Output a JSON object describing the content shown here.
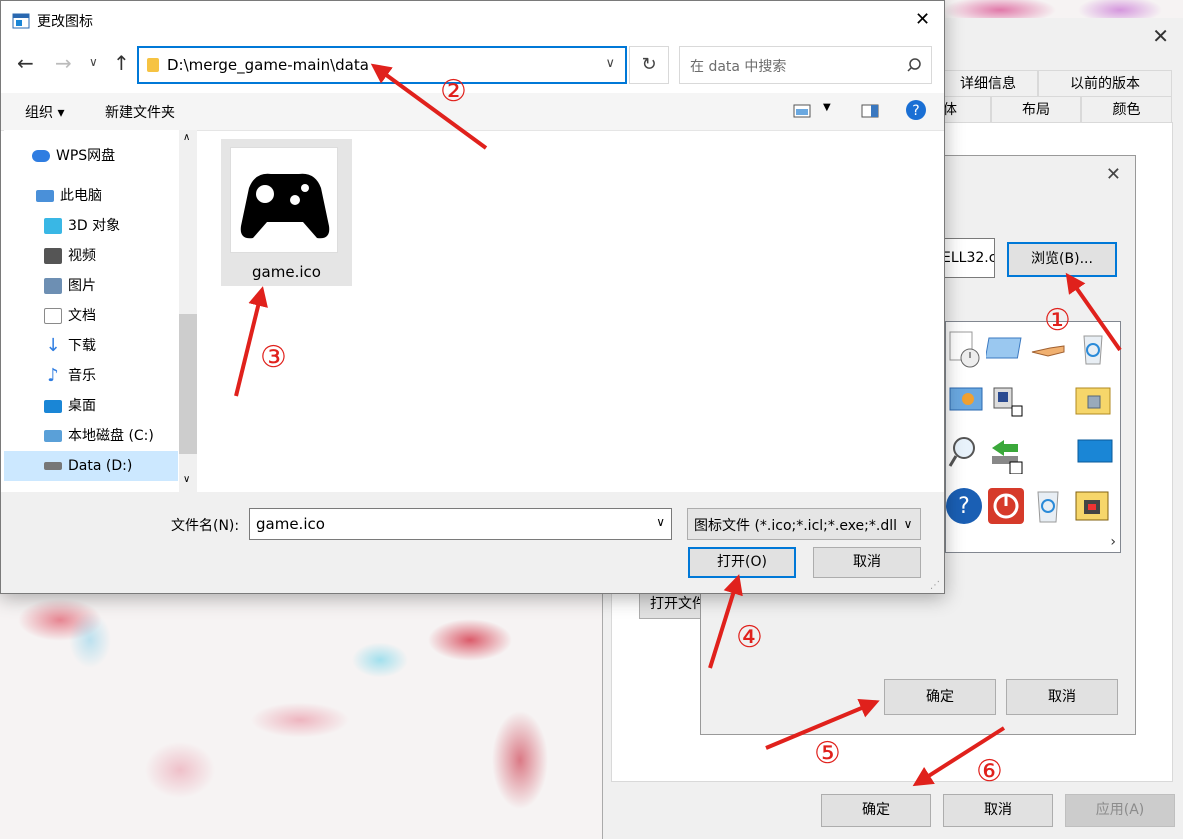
{
  "open_dialog": {
    "title": "更改图标",
    "address_path": "D:\\merge_game-main\\data",
    "search_placeholder": "在 data 中搜索",
    "toolbar": {
      "organize": "组织 ▾",
      "new_folder": "新建文件夹"
    },
    "nav_items": [
      {
        "label": "WPS网盘",
        "icon": "cloud-icon",
        "color": "#2f7de1"
      },
      {
        "label": "此电脑",
        "icon": "computer-icon",
        "color": "#4a90d9"
      },
      {
        "label": "3D 对象",
        "icon": "cube-icon",
        "color": "#39b7e5"
      },
      {
        "label": "视频",
        "icon": "film-icon",
        "color": "#555555"
      },
      {
        "label": "图片",
        "icon": "picture-icon",
        "color": "#6d8fb3"
      },
      {
        "label": "文档",
        "icon": "document-icon",
        "color": "#8a8a8a"
      },
      {
        "label": "下载",
        "icon": "download-icon",
        "color": "#2f7de1"
      },
      {
        "label": "音乐",
        "icon": "music-icon",
        "color": "#2f7de1"
      },
      {
        "label": "桌面",
        "icon": "desktop-icon",
        "color": "#1a86d6"
      },
      {
        "label": "本地磁盘 (C:)",
        "icon": "windows-drive-icon",
        "color": "#5aa0d8"
      },
      {
        "label": "Data (D:)",
        "icon": "drive-icon",
        "color": "#777777"
      }
    ],
    "file": {
      "name": "game.ico"
    },
    "filename_label": "文件名(N):",
    "filename_value": "game.ico",
    "filetype_value": "图标文件 (*.ico;*.icl;*.exe;*.dll",
    "open_button": "打开(O)",
    "cancel_button": "取消"
  },
  "change_icon_dialog": {
    "path_fragment": "ELL32.c",
    "browse_button": "浏览(B)...",
    "ok_button": "确定",
    "cancel_button": "取消"
  },
  "properties": {
    "tabs_top": [
      "详细信息",
      "以前的版本"
    ],
    "tabs_bottom": [
      "体",
      "布局",
      "颜色"
    ],
    "open_file_fragment": "打开文件",
    "ok_button": "确定",
    "cancel_button": "取消",
    "apply_button": "应用(A)"
  },
  "annotations": [
    "①",
    "②",
    "③",
    "④",
    "⑤",
    "⑥"
  ],
  "colors": {
    "accent": "#0078d7",
    "annotation": "#e0211c",
    "selection": "#e5e5e5"
  }
}
